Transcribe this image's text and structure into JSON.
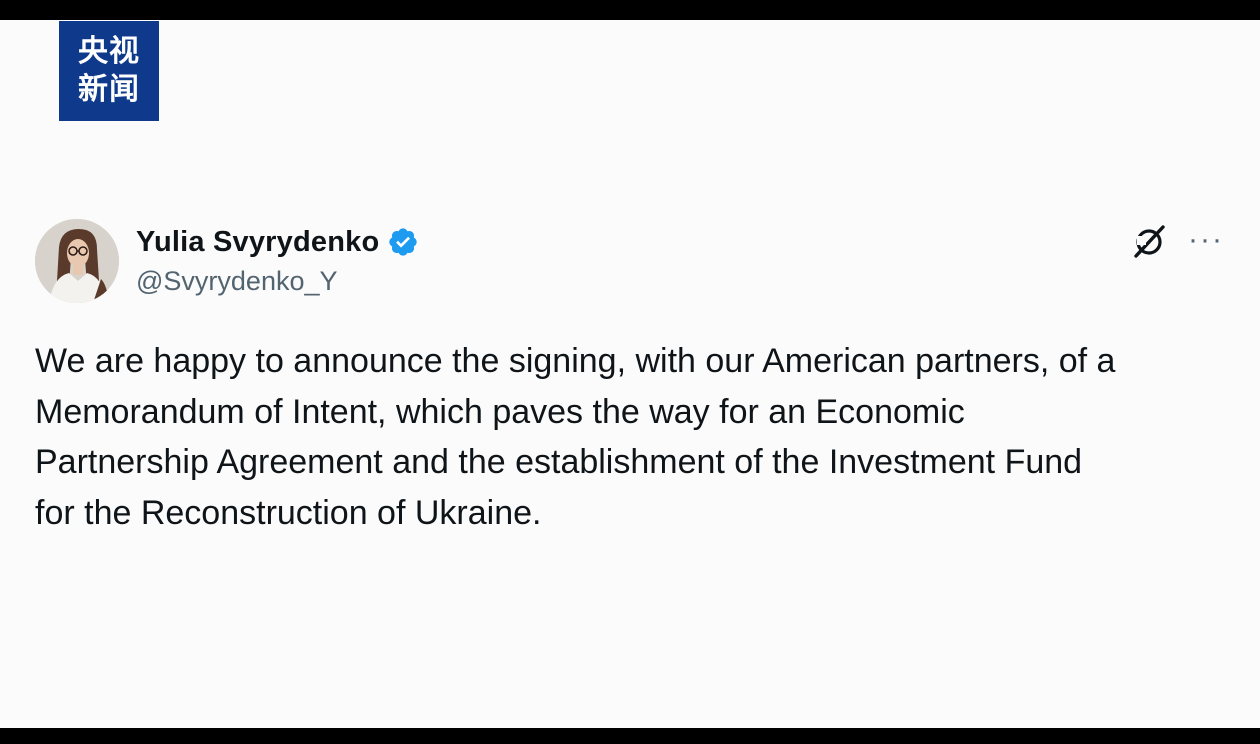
{
  "broadcaster": {
    "logo_line1": "央视",
    "logo_line2": "新闻",
    "logo_bg": "#0f3a8c"
  },
  "tweet": {
    "display_name": "Yulia Svyrydenko",
    "handle": "@Svyrydenko_Y",
    "verified": true,
    "verified_color": "#1d9bf0",
    "text": "We are happy to announce the signing, with our American partners, of a\nMemorandum of Intent, which paves the way for an Economic\nPartnership Agreement and the establishment of the Investment Fund\nfor the Reconstruction of Ukraine.",
    "icons": {
      "grok": "grok-icon",
      "more": "more-options-icon"
    },
    "more_glyph": "···"
  }
}
